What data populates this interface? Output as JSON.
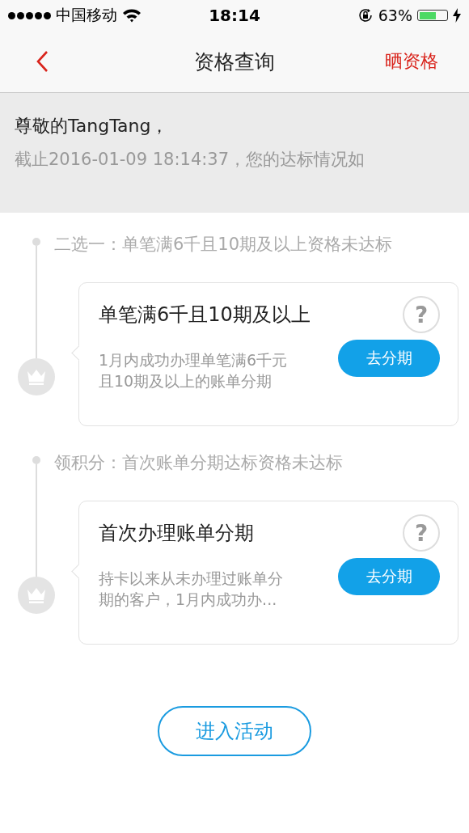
{
  "status_bar": {
    "carrier": "中国移动",
    "time": "18:14",
    "battery_percent": "63%",
    "battery": {
      "level": 0.63,
      "charging": true
    }
  },
  "nav": {
    "title": "资格查询",
    "action": "晒资格"
  },
  "header": {
    "greeting": "尊敬的TangTang，",
    "status_line": "截止2016-01-09 18:14:37，您的达标情况如"
  },
  "sections": [
    {
      "label": "二选一：单笔满6千且10期及以上资格未达标",
      "card": {
        "title": "单笔满6千且10期及以上",
        "help": "?",
        "description_lines": [
          "1月内成功办理单笔满6千元",
          "且10期及以上的账单分期"
        ],
        "button": "去分期"
      }
    },
    {
      "label": "领积分：首次账单分期达标资格未达标",
      "card": {
        "title": "首次办理账单分期",
        "help": "?",
        "description_lines": [
          "持卡以来从未办理过账单分",
          "期的客户，1月内成功办..."
        ],
        "button": "去分期"
      }
    }
  ],
  "enter_button": "进入活动"
}
